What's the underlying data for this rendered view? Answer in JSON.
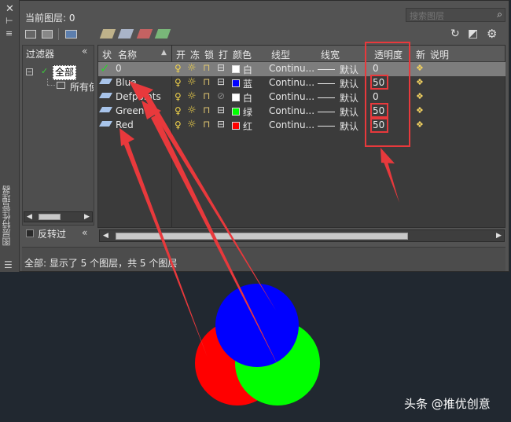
{
  "header": {
    "current_layer": "当前图层: 0",
    "search_placeholder": "搜索图层"
  },
  "filter_panel": {
    "title": "过滤器",
    "all": "全部",
    "all_used": "所有使",
    "invert": "反转过"
  },
  "table": {
    "columns": {
      "status": "状",
      "name": "名称",
      "on": "开",
      "freeze": "冻",
      "lock": "锁",
      "plot": "打",
      "color": "颜色",
      "linetype": "线型",
      "lineweight": "线宽",
      "transparency": "透明度",
      "new": "新",
      "desc": "说明"
    },
    "rows": [
      {
        "name": "0",
        "color_name": "白",
        "color_hex": "#ffffff",
        "linetype": "Continu...",
        "lineweight": "默认",
        "transparency": "0",
        "current": true
      },
      {
        "name": "Blue",
        "color_name": "蓝",
        "color_hex": "#0000ff",
        "linetype": "Continu...",
        "lineweight": "默认",
        "transparency": "50",
        "current": false
      },
      {
        "name": "Defpoints",
        "color_name": "白",
        "color_hex": "#ffffff",
        "linetype": "Continu...",
        "lineweight": "默认",
        "transparency": "0",
        "current": false
      },
      {
        "name": "Green",
        "color_name": "绿",
        "color_hex": "#00ff00",
        "linetype": "Continu...",
        "lineweight": "默认",
        "transparency": "50",
        "current": false
      },
      {
        "name": "Red",
        "color_name": "红",
        "color_hex": "#ff0000",
        "linetype": "Continu...",
        "lineweight": "默认",
        "transparency": "50",
        "current": false
      }
    ]
  },
  "status_bar": "全部: 显示了 5 个图层，共 5 个图层",
  "side_title": "图层特性管理器",
  "watermark": "头条 @推优创意",
  "colors": {
    "accent": "#e8393c",
    "red": "#ff0000",
    "green": "#00ff00",
    "blue": "#0000ff"
  }
}
